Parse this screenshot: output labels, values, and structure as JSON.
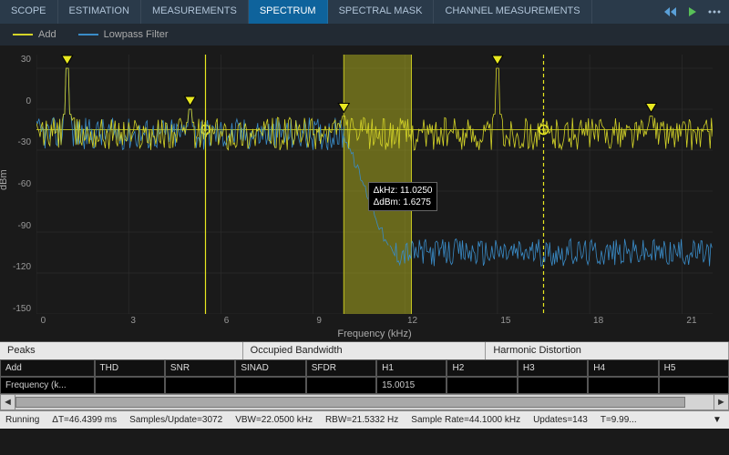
{
  "tabs": {
    "items": [
      "SCOPE",
      "ESTIMATION",
      "MEASUREMENTS",
      "SPECTRUM",
      "SPECTRAL MASK",
      "CHANNEL MEASUREMENTS"
    ],
    "active_index": 3
  },
  "legend": {
    "add": {
      "label": "Add",
      "color": "#d4d428"
    },
    "lp": {
      "label": "Lowpass Filter",
      "color": "#3a8cc8"
    }
  },
  "axes": {
    "ylabel": "dBm",
    "xlabel": "Frequency (kHz)",
    "yticks": [
      "30",
      "0",
      "-30",
      "-60",
      "-90",
      "-120",
      "-150"
    ],
    "xticks": [
      "0",
      "3",
      "6",
      "9",
      "12",
      "15",
      "18",
      "21"
    ]
  },
  "cursors": {
    "delta_khz_label": "ΔkHz: ",
    "delta_khz": "11.0250",
    "delta_dbm_label": "ΔdBm: ",
    "delta_dbm": "1.6275"
  },
  "sections": [
    "Peaks",
    "Occupied Bandwidth",
    "Harmonic Distortion"
  ],
  "table": {
    "headers": [
      "Add",
      "THD",
      "SNR",
      "SINAD",
      "SFDR",
      "H1",
      "H2",
      "H3",
      "H4",
      "H5"
    ],
    "row_label": "Frequency (k...",
    "values": {
      "H1": "15.0015"
    }
  },
  "status": {
    "running": "Running",
    "dt": "ΔT=46.4399 ms",
    "spu": "Samples/Update=3072",
    "vbw": "VBW=22.0500 kHz",
    "rbw": "RBW=21.5332 Hz",
    "rate": "Sample Rate=44.1000 kHz",
    "upd": "Updates=143",
    "t": "T=9.99..."
  },
  "chart_data": {
    "type": "line",
    "title": "Spectrum",
    "xlabel": "Frequency (kHz)",
    "ylabel": "dBm",
    "xlim": [
      0,
      22
    ],
    "ylim": [
      -150,
      40
    ],
    "series": [
      {
        "name": "Add",
        "color": "#d4d428",
        "baseline": -18,
        "noise_amp": 12,
        "peaks": [
          {
            "x": 1.0,
            "y": 30
          },
          {
            "x": 5.0,
            "y": 0
          },
          {
            "x": 10.0,
            "y": -5
          },
          {
            "x": 15.0,
            "y": 30
          },
          {
            "x": 20.0,
            "y": -5
          }
        ]
      },
      {
        "name": "Lowpass Filter",
        "color": "#3a8cc8",
        "segments": [
          {
            "x0": 0,
            "x1": 10,
            "baseline": -18,
            "noise_amp": 12
          },
          {
            "x0": 10,
            "x1": 11.5,
            "baseline_from": -18,
            "baseline_to": -105
          },
          {
            "x0": 11.5,
            "x1": 22,
            "baseline": -105,
            "noise_amp": 10
          }
        ],
        "peaks": [
          {
            "x": 1.0,
            "y": 30
          },
          {
            "x": 5.0,
            "y": 0
          }
        ]
      }
    ],
    "occupied_bw": {
      "x0": 10.0,
      "x1": 12.2,
      "color": "#c8c820"
    },
    "cursors": [
      {
        "x": 5.5,
        "style": "solid"
      },
      {
        "x": 16.5,
        "style": "dashed"
      }
    ],
    "annotations": {
      "delta_khz": 11.025,
      "delta_dbm": 1.6275
    }
  }
}
